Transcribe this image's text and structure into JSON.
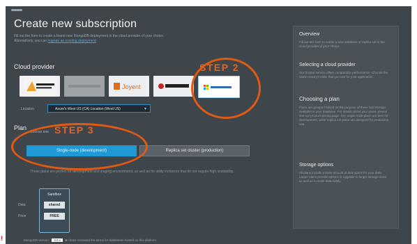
{
  "page": {
    "title": "Create new subscription",
    "intro_text": "Fill out the form to create a brand new MongoDB deployment in the cloud provider of your choice. Alternatively, you can",
    "intro_link": "migrate an existing deployment"
  },
  "cloud_provider": {
    "label": "Cloud provider",
    "providers": [
      {
        "name": "Amazon Web Services",
        "icon": "aws-logo"
      },
      {
        "name": "Google Cloud Platform",
        "icon": "gcp-logo"
      },
      {
        "name": "Joyent",
        "icon": "joyent-logo"
      },
      {
        "name": "Rackspace",
        "icon": "rackspace-logo"
      },
      {
        "name": "Windows Azure",
        "icon": "azure-logo"
      }
    ],
    "selected_index": 4,
    "location_label": "Location",
    "location_value": "Azure's West US (CA) Location (West US)"
  },
  "plan": {
    "label": "Plan",
    "sub_label": "Choose one",
    "options": [
      "Single-node (development)",
      "Replica set cluster (production)"
    ],
    "selected_index": 0,
    "description": "These plans are perfect for development and staging environments as well as for utility instances that do not require high availability.",
    "tier": {
      "name": "Sandbox",
      "storage_label": "Data",
      "storage_value": "shared",
      "price_label": "Price",
      "price_value": "FREE"
    }
  },
  "footer": {
    "version_label": "MongoDB version:",
    "version_value": "3.0.x",
    "checkbox_text": "I have reviewed the terms for databases hosted on this platform"
  },
  "sidebar": {
    "sections": [
      {
        "heading": "Overview",
        "text": "Fill out this form to create a new database or replica set in the cloud provider of your choice."
      },
      {
        "heading": "Selecting a cloud provider",
        "text": "Our hosted service offers comparable performance. Choose the same cloud provider that you use for your application."
      },
      {
        "heading": "Choosing a plan",
        "text": "Plans are grouped based on the purpose of these and storage available in your database. For details about your plans, please see our product pricing page. Our single-node plans are best for development, while replica set plans are designed for production use."
      },
      {
        "heading": "Storage options",
        "text": "All plans include a base amount of disk space for your data. Larger plans provide options to upgrade to larger storage sizes, as well as to scale data safely."
      }
    ]
  },
  "annotations": {
    "step2": "STEP 2",
    "step3": "STEP 3",
    "ring_color": "#e05a14"
  },
  "colors": {
    "background": "#3e454b",
    "accent": "#1f9ad6",
    "link": "#3fb0e6"
  }
}
